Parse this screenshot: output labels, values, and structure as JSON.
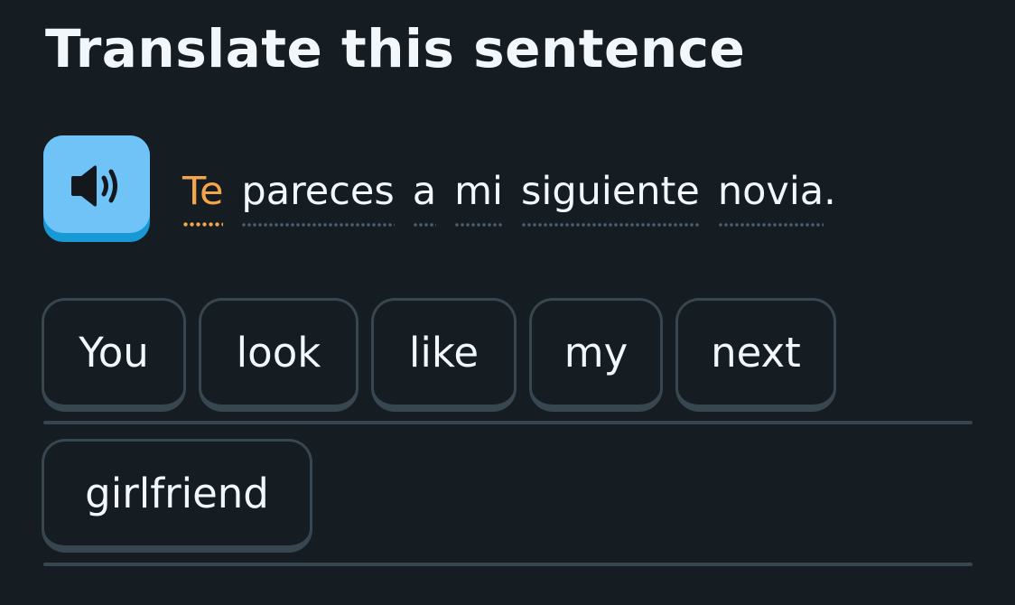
{
  "header": {
    "title": "Translate this sentence"
  },
  "prompt": {
    "audio_button_icon": "speaker-icon",
    "words": [
      {
        "text": "Te",
        "highlight": true
      },
      {
        "text": "pareces",
        "highlight": false
      },
      {
        "text": "a",
        "highlight": false
      },
      {
        "text": "mi",
        "highlight": false
      },
      {
        "text": "siguiente",
        "highlight": false
      },
      {
        "text": "novia",
        "highlight": false
      }
    ],
    "punctuation": "."
  },
  "answer": {
    "tiles": [
      "You",
      "look",
      "like",
      "my",
      "next",
      "girlfriend"
    ]
  },
  "colors": {
    "background": "#151c22",
    "text": "#f1f7fb",
    "new_word": "#f4a44b",
    "audio_button": "#6fc3f7",
    "tile_border": "#37464f"
  }
}
